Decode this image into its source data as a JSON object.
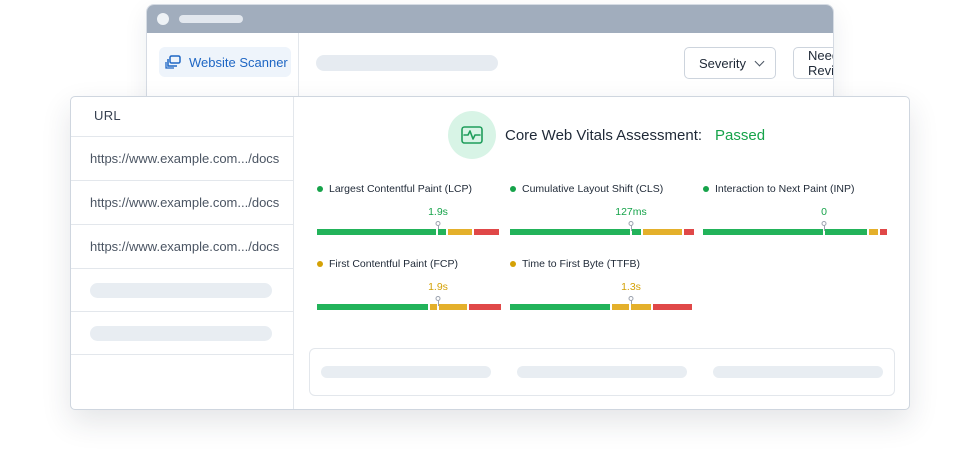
{
  "back_window": {
    "sidebar": {
      "website_scanner_label": "Website Scanner"
    },
    "toolbar": {
      "severity_label": "Severity",
      "needs_review_label": "Needs Review",
      "filter_icon": "filter-icon"
    }
  },
  "url_table": {
    "header": "URL",
    "rows": [
      "https://www.example.com.../docs",
      "https://www.example.com.../docs",
      "https://www.example.com.../docs"
    ]
  },
  "assessment": {
    "title": "Core Web Vitals Assessment:",
    "status": "Passed",
    "icon": "pulse-icon",
    "status_color": "#16a34a"
  },
  "metrics": [
    {
      "name": "Largest Contentful Paint (LCP)",
      "value": "1.9s",
      "status_color": "#16a34a",
      "marker": 0.66
    },
    {
      "name": "Cumulative Layout Shift (CLS)",
      "value": "127ms",
      "status_color": "#16a34a",
      "marker": 0.66
    },
    {
      "name": "Interaction to Next Paint (INP)",
      "value": "0",
      "status_color": "#16a34a",
      "marker": 0.66
    },
    {
      "name": "First Contentful Paint (FCP)",
      "value": "1.9s",
      "status_color": "#d4a106",
      "marker": 0.66
    },
    {
      "name": "Time to First Byte (TTFB)",
      "value": "1.3s",
      "status_color": "#d4a106",
      "marker": 0.66
    }
  ],
  "colors": {
    "good": "#22b35a",
    "needs_improvement": "#e4b02b",
    "poor": "#e04848",
    "accent": "#1e66c4"
  }
}
